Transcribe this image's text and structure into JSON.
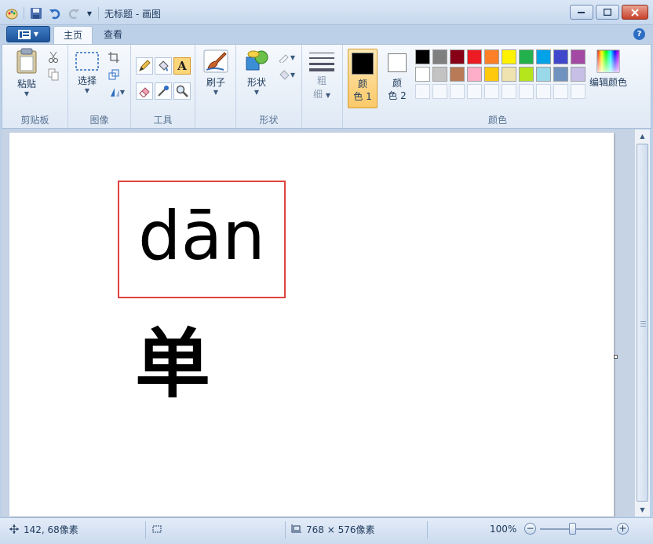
{
  "window": {
    "title": "无标题 - 画图"
  },
  "tabs": [
    {
      "label": "主页",
      "active": true
    },
    {
      "label": "查看",
      "active": false
    }
  ],
  "ribbon": {
    "clipboard": {
      "label": "剪贴板",
      "paste": "粘贴"
    },
    "image": {
      "label": "图像",
      "select": "选择"
    },
    "tools": {
      "label": "工具"
    },
    "brushes": {
      "label": "刷子"
    },
    "shapes": {
      "label": "形状",
      "shapes_btn": "形状"
    },
    "size": {
      "line1": "粗",
      "line2": "细"
    },
    "colors": {
      "label": "颜色",
      "color1_line1": "颜",
      "color1_line2": "色 1",
      "color2_line1": "颜",
      "color2_line2": "色 2",
      "edit": "编辑颜色",
      "color1_value": "#000000",
      "color2_value": "#ffffff",
      "palette": [
        "#000000",
        "#7f7f7f",
        "#880015",
        "#ed1c24",
        "#ff7f27",
        "#fff200",
        "#22b14c",
        "#00a2e8",
        "#3f48cc",
        "#a349a4",
        "#ffffff",
        "#c3c3c3",
        "#b97a57",
        "#ffaec9",
        "#ffc90e",
        "#efe4b0",
        "#b5e61d",
        "#99d9ea",
        "#7092be",
        "#c8bfe7"
      ]
    }
  },
  "canvas": {
    "pinyin": "dān",
    "hanzi": "单"
  },
  "status": {
    "cursor_pos": "142, 68像素",
    "image_size": "768 × 576像素",
    "zoom": "100%"
  }
}
